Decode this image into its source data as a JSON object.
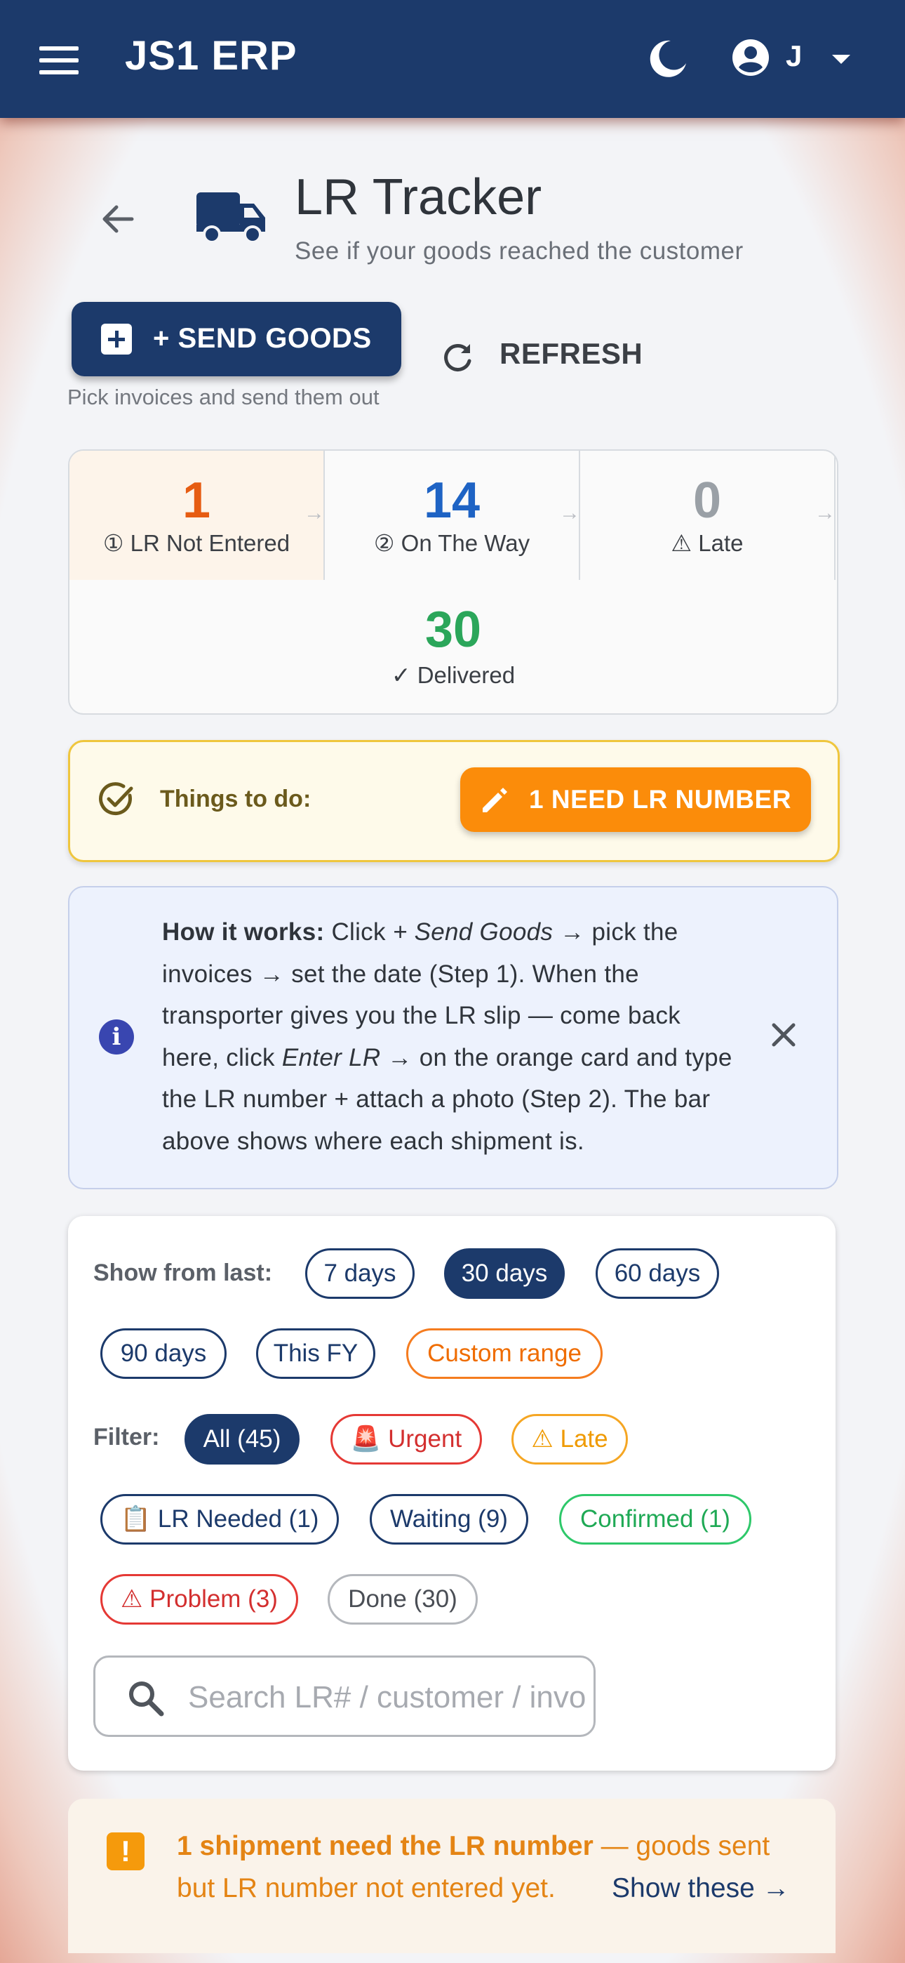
{
  "appbar": {
    "title": "JS1 ERP",
    "user_initial": "J"
  },
  "header": {
    "title": "LR Tracker",
    "subtitle": "See if your goods reached the customer"
  },
  "actions": {
    "send_goods": "+ SEND GOODS",
    "refresh": "REFRESH",
    "send_help": "Pick invoices and send them out"
  },
  "stats": [
    {
      "count": "1",
      "label": "① LR Not Entered",
      "color": "#e65c12"
    },
    {
      "count": "14",
      "label": "② On The Way",
      "color": "#1e63c4"
    },
    {
      "count": "0",
      "label": "⚠ Late",
      "color": "#9aa0a6"
    },
    {
      "count": "30",
      "label": "✓ Delivered",
      "color": "#2ba65a"
    }
  ],
  "arrow": "→",
  "todo": {
    "label": "Things to do:",
    "button": "1 NEED LR NUMBER"
  },
  "info": {
    "lead": "How it works:",
    "p1": " Click ",
    "em1": "+ Send Goods",
    "p2": " → pick the invoices → set the date (Step 1). When the transporter gives you the LR slip — come back here, click ",
    "em2": "Enter LR →",
    "p3": " on the orange card and type the LR number + attach a photo (Step 2). The bar above shows where each shipment is."
  },
  "period": {
    "label": "Show from last:",
    "options": [
      "7 days",
      "30 days",
      "60 days",
      "90 days",
      "This FY",
      "Custom range"
    ],
    "selected": "30 days"
  },
  "filter": {
    "label": "Filter:",
    "options": [
      "All (45)",
      "🚨 Urgent",
      "⚠ Late",
      "📋 LR Needed (1)",
      "Waiting (9)",
      "Confirmed (1)",
      "⚠ Problem (3)",
      "Done (30)"
    ],
    "selected": "All (45)"
  },
  "search": {
    "placeholder": "Search LR# / customer / invoice"
  },
  "alert": {
    "bold": "1 shipment need the LR number",
    "rest": " — goods sent",
    "line2": "but LR number not entered yet.",
    "link": "Show these →"
  },
  "colors": {
    "primary": "#1c3a6b",
    "accent_orange": "#fb8c0a",
    "todo_border": "#efc63d"
  }
}
